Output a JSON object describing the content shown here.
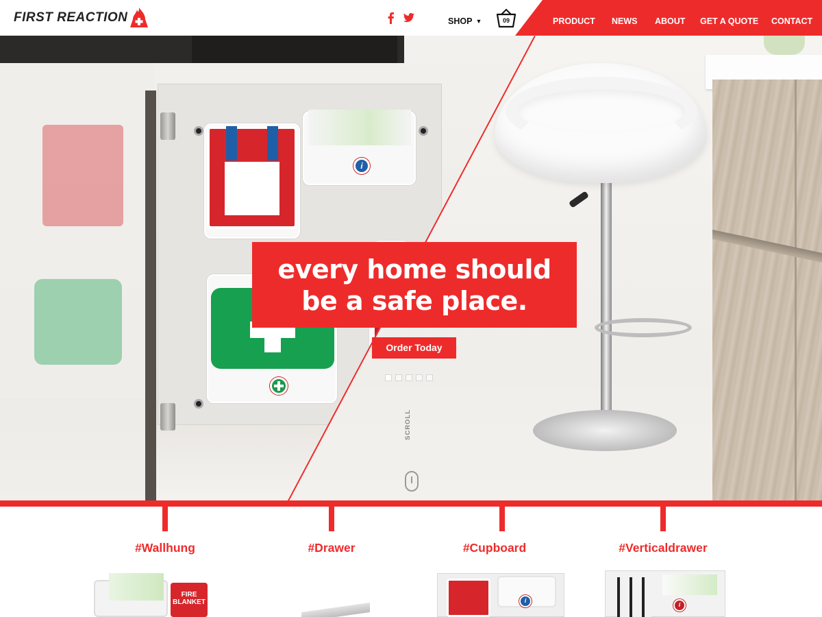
{
  "brand": {
    "name": "FIRST REACTION"
  },
  "header": {
    "shop_label": "SHOP",
    "cart_count": "09",
    "nav": [
      "PRODUCT",
      "NEWS",
      "ABOUT",
      "GET A QUOTE",
      "CONTACT"
    ]
  },
  "hero": {
    "headline_line1": "every home should",
    "headline_line2": "be a safe place.",
    "cta": "Order Today",
    "scroll_label": "SCROLL",
    "slide_count": 5,
    "active_slide": 1
  },
  "categories": [
    "#Wallhung",
    "#Drawer",
    "#Cupboard",
    "#Verticaldrawer"
  ],
  "product_text": {
    "fire_blanket": "FIRE BLANKET"
  },
  "colors": {
    "accent": "#ee2b2b",
    "text": "#111111"
  },
  "icons": [
    "flame-cross-logo-icon",
    "facebook-icon",
    "twitter-icon",
    "caret-down-icon",
    "basket-icon",
    "mouse-scroll-icon",
    "info-icon",
    "first-aid-cross-icon"
  ]
}
